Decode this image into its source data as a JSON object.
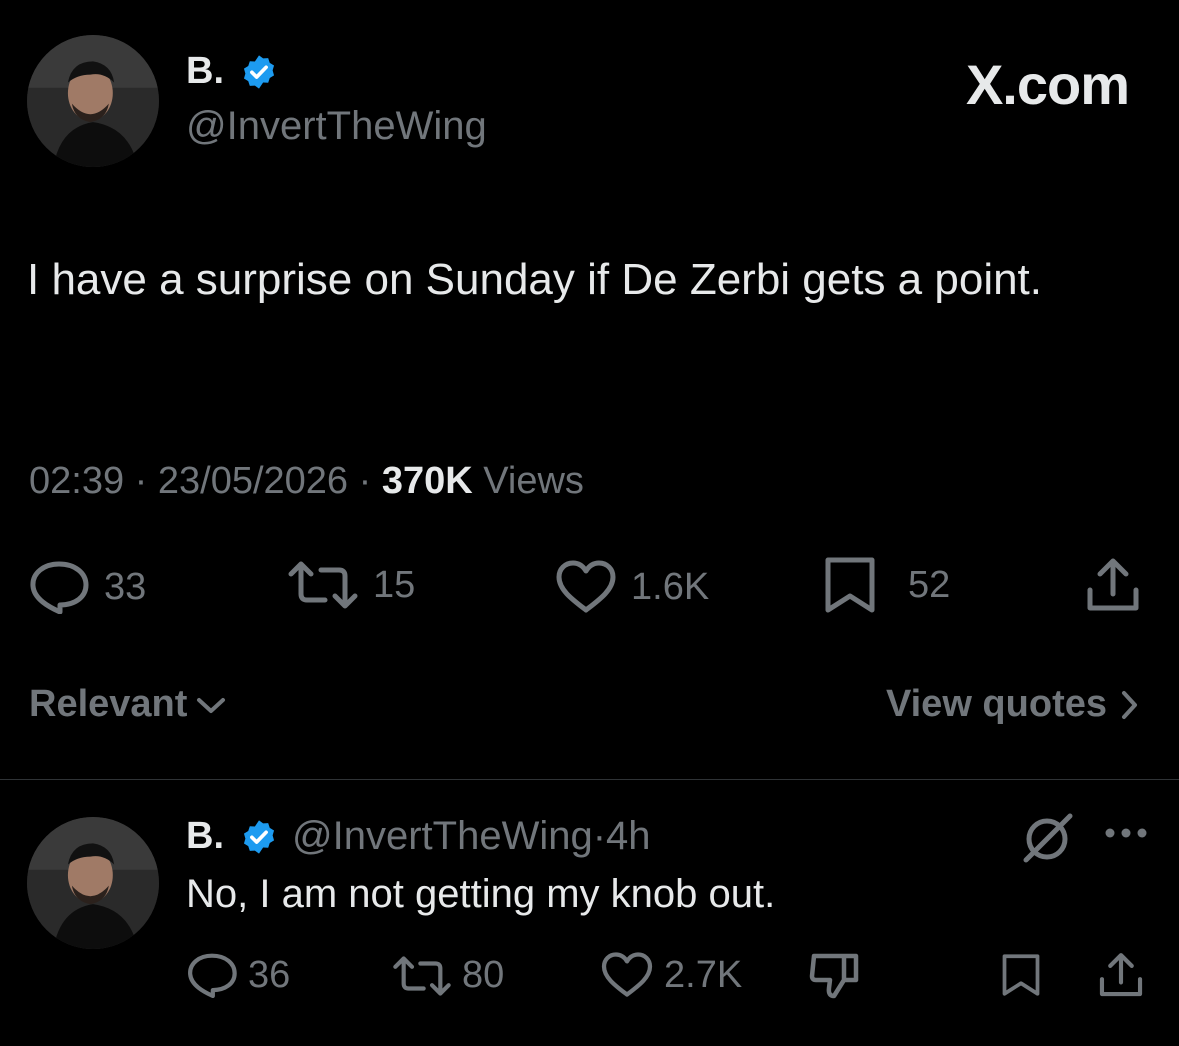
{
  "brand": {
    "watermark": "X.com"
  },
  "tweet": {
    "author": {
      "name": "B.",
      "handle": "@InvertTheWing",
      "verified": true
    },
    "text": "I have a surprise on Sunday if De Zerbi gets a point.",
    "time": "02:39",
    "separator": "·",
    "date": "23/05/2026",
    "views_count": "370K",
    "views_label": "Views",
    "actions": {
      "replies": "33",
      "reposts": "15",
      "likes": "1.6K",
      "bookmarks": "52"
    }
  },
  "sort": {
    "label": "Relevant"
  },
  "view_quotes": {
    "label": "View quotes"
  },
  "reply": {
    "author": {
      "name": "B.",
      "handle": "@InvertTheWing",
      "verified": true
    },
    "meta": "·4h",
    "text": "No, I am not getting my knob out.",
    "actions": {
      "replies": "36",
      "reposts": "80",
      "likes": "2.7K"
    }
  },
  "colors": {
    "background": "#000000",
    "text": "#e7e9ea",
    "muted": "#71767b",
    "verified_blue": "#1d9bf0",
    "divider": "#2f3336"
  },
  "icons": [
    "reply-icon",
    "repost-icon",
    "like-icon",
    "bookmark-icon",
    "share-icon",
    "chevron-down-icon",
    "chevron-right-icon",
    "grok-icon",
    "more-icon",
    "verified-badge-icon",
    "dislike-icon"
  ]
}
